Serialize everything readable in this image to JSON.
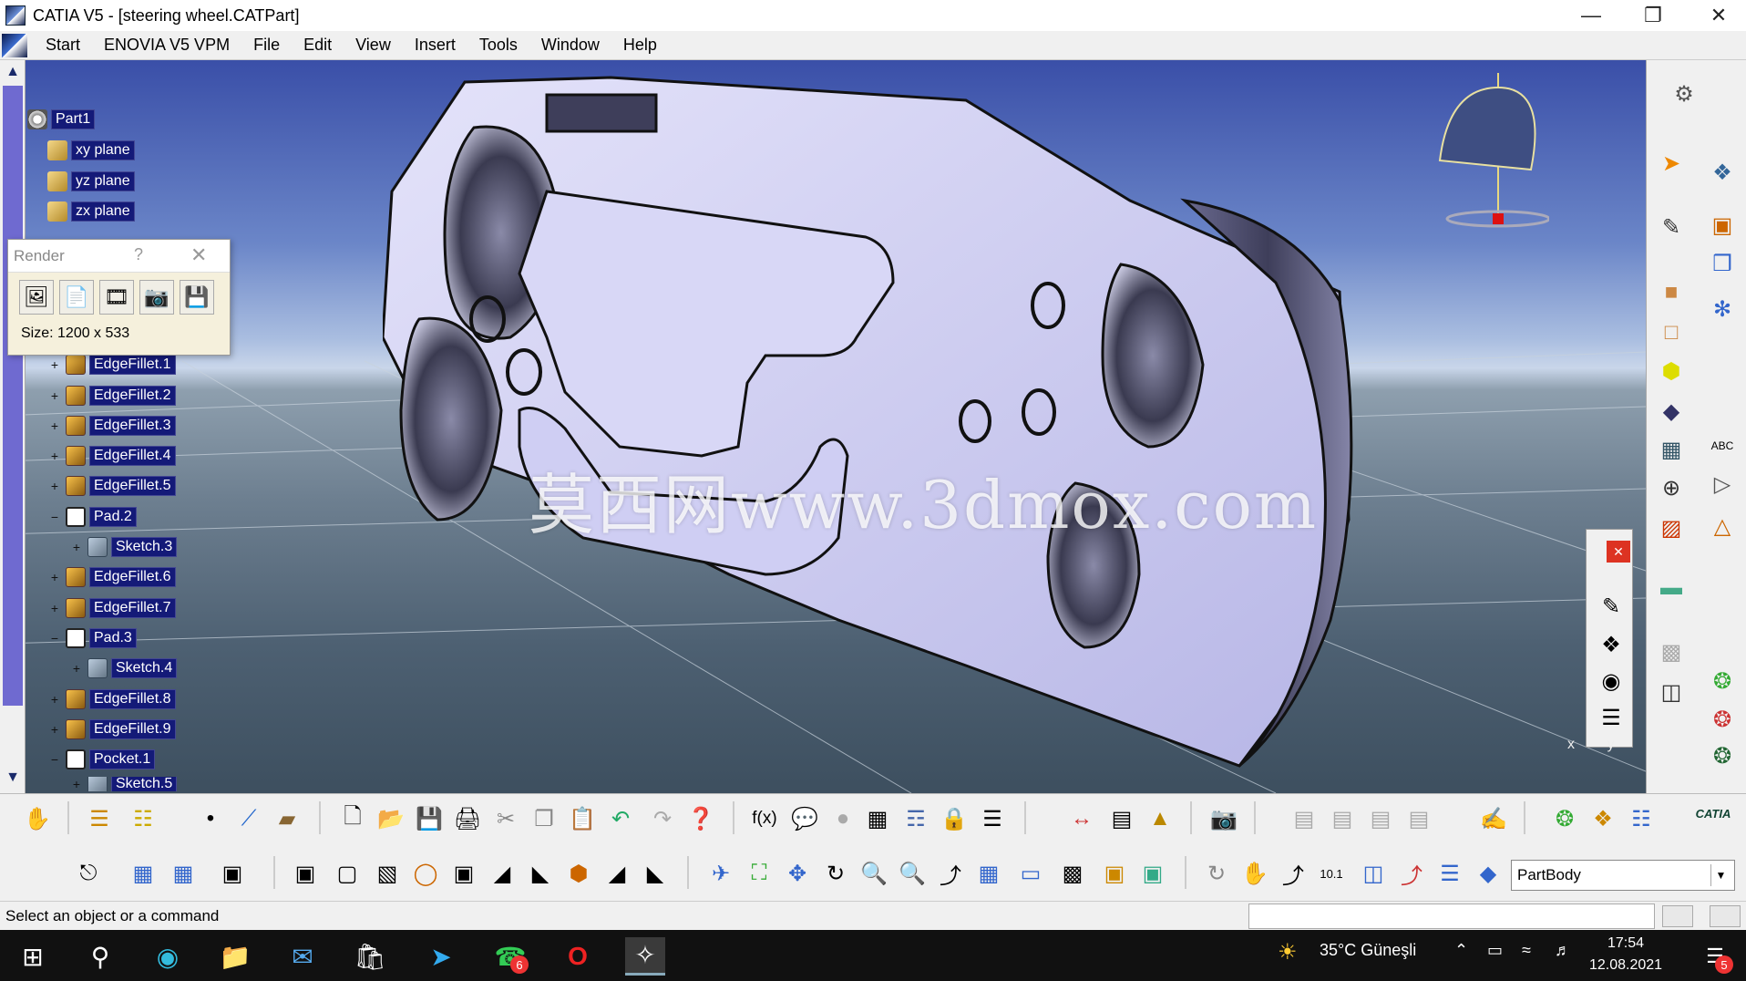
{
  "app": {
    "title": "CATIA V5 - [steering wheel.CATPart]"
  },
  "menu": {
    "items": [
      "Start",
      "ENOVIA V5 VPM",
      "File",
      "Edit",
      "View",
      "Insert",
      "Tools",
      "Window",
      "Help"
    ]
  },
  "tree": {
    "root": "Part1",
    "nodes": [
      {
        "label": "xy plane",
        "icon": "plane-icon"
      },
      {
        "label": "yz plane",
        "icon": "plane-icon"
      },
      {
        "label": "zx plane",
        "icon": "plane-icon"
      },
      {
        "label": "EdgeFillet.1",
        "icon": "edge-fillet-icon"
      },
      {
        "label": "EdgeFillet.2",
        "icon": "edge-fillet-icon"
      },
      {
        "label": "EdgeFillet.3",
        "icon": "edge-fillet-icon"
      },
      {
        "label": "EdgeFillet.4",
        "icon": "edge-fillet-icon"
      },
      {
        "label": "EdgeFillet.5",
        "icon": "edge-fillet-icon"
      },
      {
        "label": "Pad.2",
        "icon": "pad-icon"
      },
      {
        "label": "Sketch.3",
        "icon": "sketch-icon"
      },
      {
        "label": "EdgeFillet.6",
        "icon": "edge-fillet-icon"
      },
      {
        "label": "EdgeFillet.7",
        "icon": "edge-fillet-icon"
      },
      {
        "label": "Pad.3",
        "icon": "pad-icon"
      },
      {
        "label": "Sketch.4",
        "icon": "sketch-icon"
      },
      {
        "label": "EdgeFillet.8",
        "icon": "edge-fillet-icon"
      },
      {
        "label": "EdgeFillet.9",
        "icon": "edge-fillet-icon"
      },
      {
        "label": "Pocket.1",
        "icon": "pocket-icon"
      },
      {
        "label": "Sketch.5",
        "icon": "sketch-icon"
      }
    ]
  },
  "render_dialog": {
    "title": "Render",
    "help": "?",
    "size_label": "Size: 1200 x 533"
  },
  "watermark": "莫西网www.3dmox.com",
  "toolbar": {
    "body_select": "PartBody",
    "fx_label": "f(x)",
    "catia_logo": "CATIA"
  },
  "status": {
    "message": "Select an object or a command"
  },
  "taskbar": {
    "weather": "35°C Güneşli",
    "time": "17:54",
    "date": "12.08.2021",
    "whatsapp_badge": "6",
    "notif_badge": "5"
  },
  "viewport": {
    "axis_x": "x",
    "axis_y": "y"
  },
  "colors": {
    "tree_selected": "#141a78",
    "scroll_thumb": "#6f6ad0",
    "part_body": "#c9c8f0"
  }
}
